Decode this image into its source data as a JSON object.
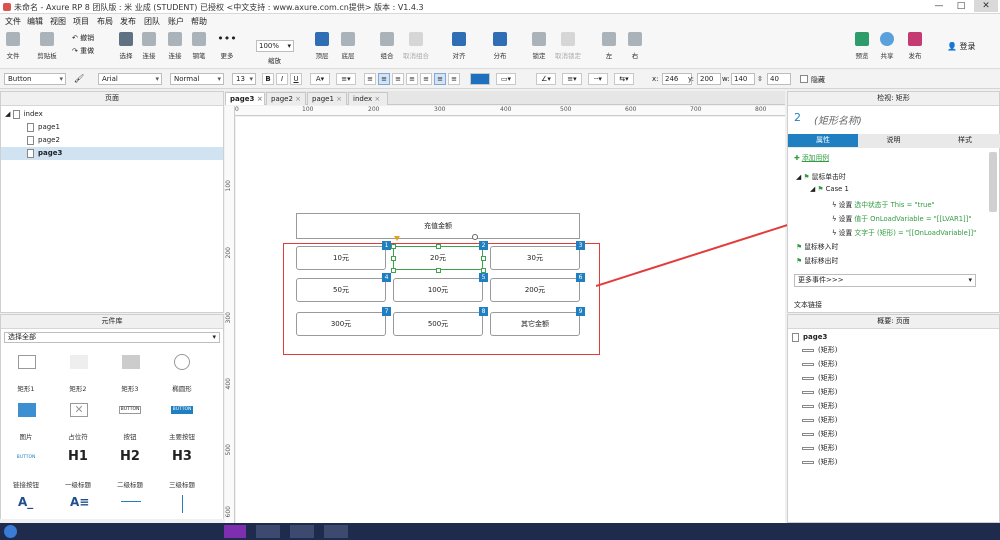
{
  "title": "未命名 - Axure RP 8 团队版 : 米 业成 (STUDENT) 已授权   <中文支持 : www.axure.com.cn提供> 版本 : V1.4.3",
  "menu": [
    "文件",
    "编辑",
    "视图",
    "项目",
    "布局",
    "发布",
    "团队",
    "账户",
    "帮助"
  ],
  "toolbar": {
    "file": "文件",
    "clipboard": "剪贴板",
    "undo": "撤销",
    "redo": "重做",
    "select": "选择",
    "connect": "连接",
    "pen": "钢笔",
    "more": "更多",
    "zoom_value": "100%",
    "zoom_label": "缩放",
    "top": "顶层",
    "bottom": "底层",
    "group": "组合",
    "ungroup": "取消组合",
    "align": "对齐",
    "distribute": "分布",
    "lock": "锁定",
    "unlock": "取消锁定",
    "left": "左",
    "right": "右",
    "preview": "预览",
    "share": "共享",
    "publish": "发布",
    "login": "登录"
  },
  "format": {
    "widget_type": "Button",
    "font": "Arial",
    "style": "Normal",
    "size": "13",
    "x_label": "x:",
    "x": "246",
    "y_label": "y:",
    "y": "200",
    "w_label": "w:",
    "w": "140",
    "h_label": "",
    "h": "40",
    "hidden": "隐藏"
  },
  "pages_panel": {
    "title": "页面",
    "items": [
      {
        "label": "index"
      },
      {
        "label": "page1"
      },
      {
        "label": "page2"
      },
      {
        "label": "page3"
      }
    ]
  },
  "library": {
    "title": "元件库",
    "filter": "选择全部",
    "widgets": [
      "矩形1",
      "矩形2",
      "矩形3",
      "椭圆形",
      "图片",
      "占位符",
      "按钮",
      "主要按钮",
      "链接按钮",
      "一级标题",
      "二级标题",
      "三级标题"
    ],
    "button_text": "BUTTON",
    "h_glyphs": [
      "H1",
      "H2",
      "H3"
    ],
    "bottom_title": "母版"
  },
  "tabs": [
    "page3",
    "page2",
    "page1",
    "index"
  ],
  "ruler_top": [
    "0",
    "100",
    "200",
    "300",
    "400",
    "500",
    "600",
    "700",
    "800"
  ],
  "ruler_left": [
    "100",
    "200",
    "300",
    "400",
    "500",
    "600"
  ],
  "canvas": {
    "header": "充值金额",
    "buttons": [
      "10元",
      "20元",
      "30元",
      "50元",
      "100元",
      "200元",
      "300元",
      "500元",
      "其它金额"
    ],
    "badges": [
      "1",
      "2",
      "3",
      "4",
      "5",
      "6",
      "7",
      "8",
      "9"
    ]
  },
  "inspector": {
    "title": "检视: 矩形",
    "number": "2",
    "name_placeholder": "(矩形名称)",
    "tabs": [
      "属性",
      "说明",
      "样式"
    ],
    "add_case": "添加用例",
    "events": {
      "click": "鼠标单击时",
      "case": "Case 1",
      "a1_pre": "设置",
      "a1": "选中状态于 This = \"true\"",
      "a2_pre": "设置",
      "a2": "值于 OnLoadVariable = \"[[LVAR1]]\"",
      "a3_pre": "设置",
      "a3": "文字于 (矩形) = \"[[OnLoadVariable]]\"",
      "enter": "鼠标移入时",
      "leave": "鼠标移出时"
    },
    "more_events": "更多事件>>>",
    "text_link": "文本链接"
  },
  "outline": {
    "title": "概要: 页面",
    "page": "page3",
    "items": [
      "(矩形)",
      "(矩形)",
      "(矩形)",
      "(矩形)",
      "(矩形)",
      "(矩形)",
      "(矩形)",
      "(矩形)",
      "(矩形)"
    ]
  },
  "colors": {
    "accent": "#1f7fc1",
    "selection": "#cfe3f3",
    "red_outline": "#e33b3b",
    "event_green": "#2e9c3f"
  }
}
